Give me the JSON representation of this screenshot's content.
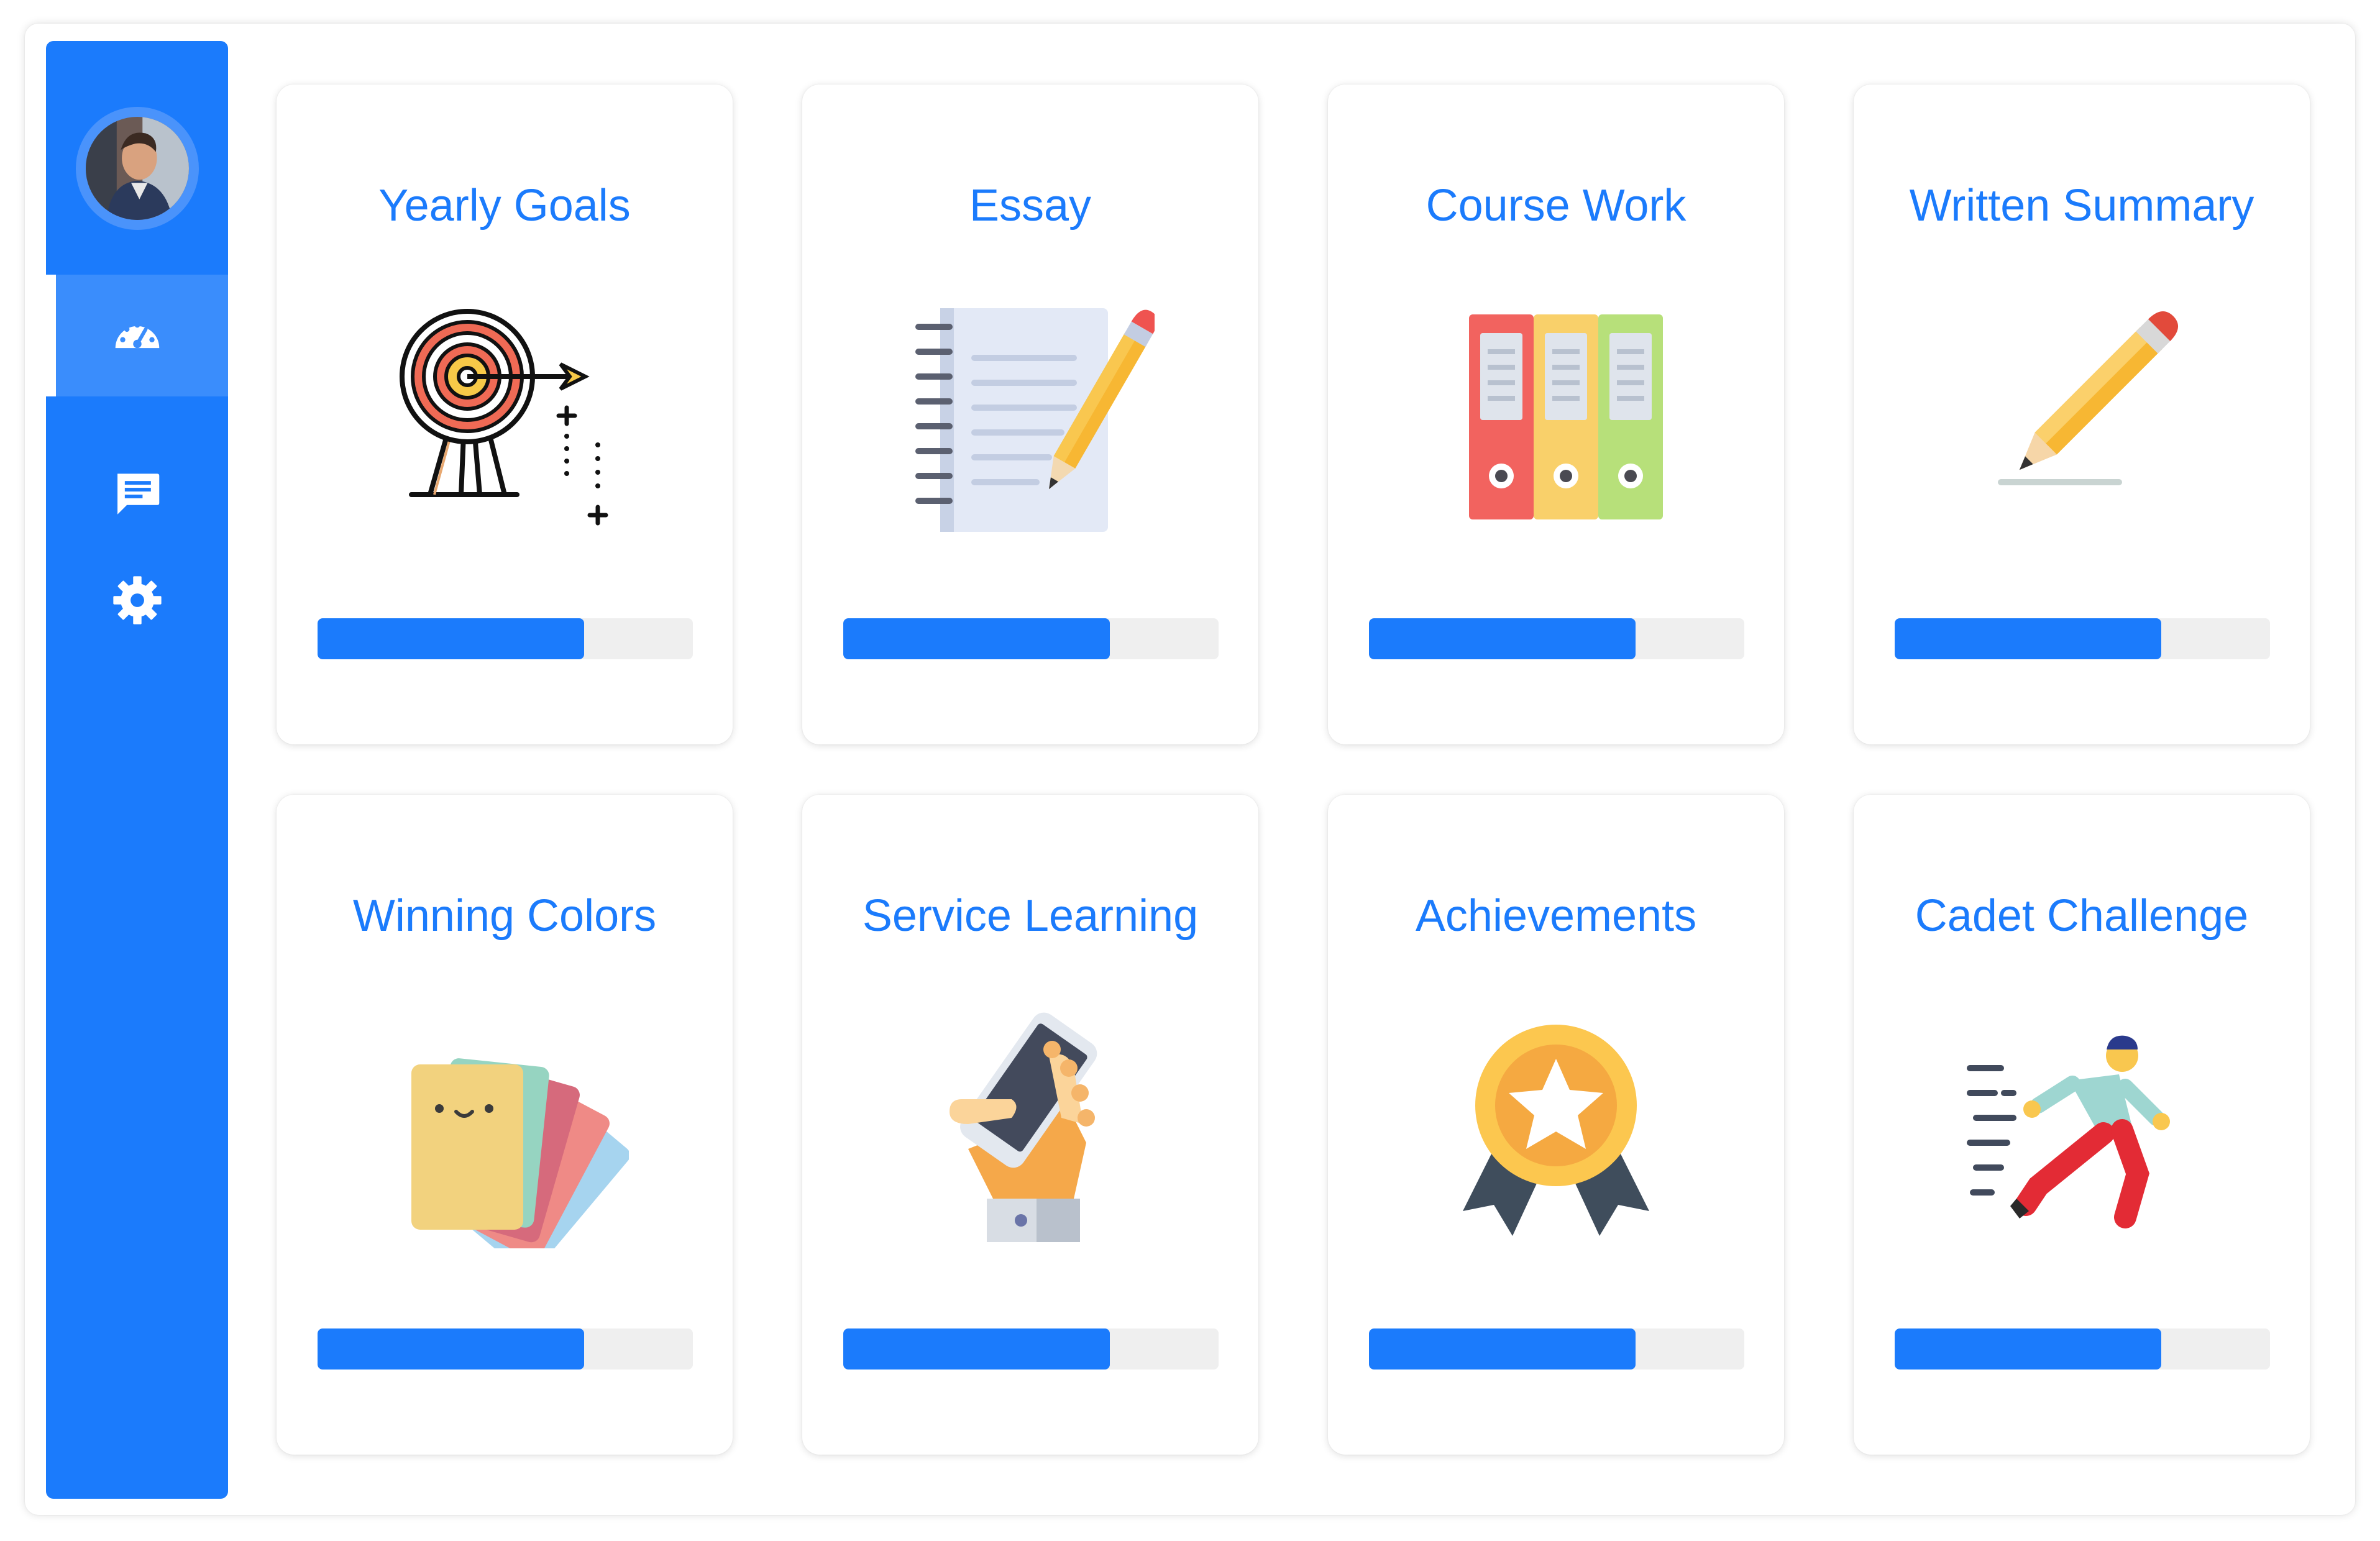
{
  "sidebar": {
    "avatar_label": "user avatar",
    "nav": [
      {
        "id": "dashboard",
        "icon": "speedometer-icon",
        "active": true
      },
      {
        "id": "messages",
        "icon": "chat-icon",
        "active": false
      },
      {
        "id": "settings",
        "icon": "gear-icon",
        "active": false
      }
    ]
  },
  "colors": {
    "accent": "#1b7bfc",
    "track": "#efefef",
    "card_bg": "#ffffff"
  },
  "cards": [
    {
      "title": "Yearly Goals",
      "icon": "target-archery-icon",
      "progress": 0.71
    },
    {
      "title": "Essay",
      "icon": "notebook-pencil-icon",
      "progress": 0.71
    },
    {
      "title": "Course Work",
      "icon": "binders-icon",
      "progress": 0.71
    },
    {
      "title": "Written Summary",
      "icon": "pencil-icon",
      "progress": 0.71
    },
    {
      "title": "Winning Colors",
      "icon": "color-cards-icon",
      "progress": 0.71
    },
    {
      "title": "Service Learning",
      "icon": "hand-phone-icon",
      "progress": 0.71
    },
    {
      "title": "Achievements",
      "icon": "award-medal-icon",
      "progress": 0.71
    },
    {
      "title": "Cadet Challenge",
      "icon": "running-person-icon",
      "progress": 0.71
    }
  ]
}
